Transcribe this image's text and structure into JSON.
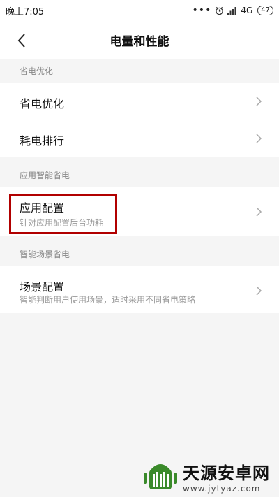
{
  "status_bar": {
    "time": "晚上7:05",
    "dots": "•••",
    "alarm_icon": "alarm-icon",
    "signal_icon": "signal-icon",
    "network": "4G",
    "battery": "47"
  },
  "header": {
    "back_icon": "chevron-left-icon",
    "title": "电量和性能"
  },
  "sections": [
    {
      "header": "省电优化",
      "rows": [
        {
          "title": "省电优化"
        },
        {
          "title": "耗电排行"
        }
      ]
    },
    {
      "header": "应用智能省电",
      "rows": [
        {
          "title": "应用配置",
          "subtitle": "针对应用配置后台功耗"
        }
      ]
    },
    {
      "header": "智能场景省电",
      "rows": [
        {
          "title": "场景配置",
          "subtitle": "智能判断用户使用场景，适时采用不同省电策略"
        }
      ]
    }
  ],
  "watermark": {
    "title": "天源安卓网",
    "url": "www.jytyaz.com",
    "logo_icon": "android-logo-icon"
  },
  "colors": {
    "highlight": "#b10000",
    "background": "#f5f5f5"
  }
}
